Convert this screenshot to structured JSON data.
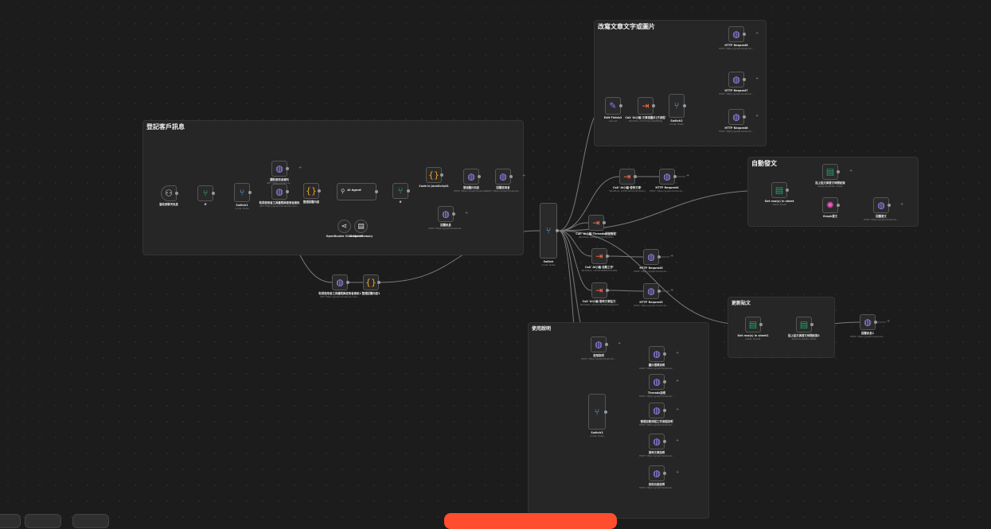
{
  "sticky_notes": [
    {
      "id": "s1",
      "title": "登記客戶訊息"
    },
    {
      "id": "s2",
      "title": "改寫文章文字或圖片"
    },
    {
      "id": "s3",
      "title": "自動發文"
    },
    {
      "id": "s4",
      "title": "使用說明"
    },
    {
      "id": "s5",
      "title": "更新貼文"
    }
  ],
  "nodes": [
    {
      "id": "n_trigger",
      "name": "當收到聊天訊息",
      "sub": "",
      "icon": "trigger-icon"
    },
    {
      "id": "n_if1",
      "name": "If",
      "sub": "",
      "icon": "if-icon"
    },
    {
      "id": "n_switch1",
      "name": "Switch1",
      "sub": "mode: Rules",
      "icon": "switch-icon"
    },
    {
      "id": "n_http_a",
      "name": "讀取使用者資料",
      "sub": "GET: https://graph.fa...",
      "icon": "globe-icon"
    },
    {
      "id": "n_http_b",
      "name": "取得使用者工具權限與使用者資訊",
      "sub": "GET: https://graph.facebook.com/...",
      "icon": "globe-icon"
    },
    {
      "id": "n_code1",
      "name": "整理回覆內容",
      "sub": "",
      "icon": "code-icon"
    },
    {
      "id": "n_agent",
      "name": "AI Agent",
      "sub": "",
      "icon": "agent-icon"
    },
    {
      "id": "n_model",
      "name": "OpenRouter Chat Model",
      "sub": "",
      "icon": "model-icon"
    },
    {
      "id": "n_memory",
      "name": "Simple Memory",
      "sub": "",
      "icon": "memory-icon"
    },
    {
      "id": "n_if2",
      "name": "If",
      "sub": "",
      "icon": "if-icon"
    },
    {
      "id": "n_code2",
      "name": "Code in JavaScript1",
      "sub": "",
      "icon": "code-icon"
    },
    {
      "id": "n_http_c",
      "name": "發送圖片訊息",
      "sub": "POST: https://graph.facebook...",
      "icon": "globe-icon"
    },
    {
      "id": "n_http_d",
      "name": "回覆使用者",
      "sub": "POST: https://graph.facebook...",
      "icon": "globe-icon"
    },
    {
      "id": "n_http_e",
      "name": "回覆訊息",
      "sub": "POST: https://graph.facebook...",
      "icon": "globe-icon"
    },
    {
      "id": "n_http_f",
      "name": "取得使用者工具權限與使用者資訊1",
      "sub": "GET: https://graph.facebook.com/...",
      "icon": "globe-icon"
    },
    {
      "id": "n_code3",
      "name": "整理回覆內容1",
      "sub": "",
      "icon": "code-icon"
    },
    {
      "id": "n_switch_main",
      "name": "Switch",
      "sub": "mode: Rules",
      "icon": "switch-icon"
    },
    {
      "id": "n_edit",
      "name": "Edit Fields2",
      "sub": "manual",
      "icon": "edit-icon"
    },
    {
      "id": "n_exec1",
      "name": "Call 'AI小編-文章或圖片]子流程'",
      "sub": "Workflow: tmFcDyb7pNvtNDgJ",
      "icon": "exec-icon"
    },
    {
      "id": "n_switch2",
      "name": "Switch2",
      "sub": "mode: Rules",
      "icon": "switch-icon"
    },
    {
      "id": "n_http_g",
      "name": "HTTP Request6",
      "sub": "POST: https://graph.facebook...",
      "icon": "globe-icon"
    },
    {
      "id": "n_http_h",
      "name": "HTTP Request7",
      "sub": "POST: https://graph.facebook...",
      "icon": "globe-icon"
    },
    {
      "id": "n_http_i",
      "name": "HTTP Request8",
      "sub": "POST: https://graph.facebook...",
      "icon": "globe-icon"
    },
    {
      "id": "n_exec2",
      "name": "Call 'AI小編-發佈文章'",
      "sub": "Workflow: zUtzTrwkCkbdmWiwnj",
      "icon": "exec-icon"
    },
    {
      "id": "n_http_j",
      "name": "HTTP Request4",
      "sub": "POST: https://graph.facebook...",
      "icon": "globe-icon"
    },
    {
      "id": "n_exec3",
      "name": "Call 'AI小編-Threads帳號管理'",
      "sub": "Workflow: p6mgk4rnTJm9nXtvu",
      "icon": "exec-icon"
    },
    {
      "id": "n_exec4",
      "name": "Call 'AI小編-自動工作'",
      "sub": "Workflow: nUrTNmN6PwHUreMa",
      "icon": "exec-icon"
    },
    {
      "id": "n_http_k",
      "name": "HTTP Request5",
      "sub": "POST: https://graph.facebook...",
      "icon": "globe-icon"
    },
    {
      "id": "n_exec5",
      "name": "Call 'AI小編-發佈文章貼文'",
      "sub": "Workflow: vlvmwYnWHkHwtpqUmf",
      "icon": "exec-icon"
    },
    {
      "id": "n_http_l",
      "name": "HTTP Request3",
      "sub": "POST: https://graph.facebook...",
      "icon": "globe-icon"
    },
    {
      "id": "n_sheet1",
      "name": "Get row(s) in sheet",
      "sub": "sheet: sheet",
      "icon": "sheet-icon"
    },
    {
      "id": "n_sheet2",
      "name": "貼上貼文與發文時間紀錄",
      "sub": "append/update: sheet",
      "icon": "sheet-icon"
    },
    {
      "id": "n_graph",
      "name": "Graph發文",
      "sub": "",
      "icon": "graph-icon"
    },
    {
      "id": "n_http_m",
      "name": "回覆發文",
      "sub": "POST: https://graph.facebook...",
      "icon": "globe-icon"
    },
    {
      "id": "n_sheet3",
      "name": "Get row(s) in sheet1",
      "sub": "sheet: sheet1",
      "icon": "sheet-icon"
    },
    {
      "id": "n_sheet4",
      "name": "貼上貼文與發文時間紀錄1",
      "sub": "append/update: sheet",
      "icon": "sheet-icon"
    },
    {
      "id": "n_http_n",
      "name": "回覆訊息1",
      "sub": "POST: https://graph.facebook...",
      "icon": "globe-icon"
    },
    {
      "id": "n_http_o",
      "name": "使用說明",
      "sub": "POST: https://graph.facebook...",
      "icon": "globe-icon"
    },
    {
      "id": "n_switch3",
      "name": "Switch3",
      "sub": "mode: Rules",
      "icon": "switch-icon"
    },
    {
      "id": "n_http_p",
      "name": "圖片選單說明",
      "sub": "POST: https://graph.facebook...",
      "icon": "globe-icon"
    },
    {
      "id": "n_http_q",
      "name": "Threads說明",
      "sub": "POST: https://graph.facebook...",
      "icon": "globe-icon"
    },
    {
      "id": "n_http_r",
      "name": "管理自動排程工作流程說明",
      "sub": "POST: https://graph.facebook...",
      "icon": "globe-icon"
    },
    {
      "id": "n_http_s",
      "name": "發佈文章說明",
      "sub": "POST: https://graph.facebook...",
      "icon": "globe-icon"
    },
    {
      "id": "n_http_t",
      "name": "其他功能說明",
      "sub": "POST: https://graph.facebook...",
      "icon": "globe-icon"
    }
  ],
  "icons": {
    "globe-icon": "◍",
    "switch-icon": "⑂",
    "if-icon": "⑂",
    "code-icon": "{}",
    "exec-icon": "⇥",
    "sheet-icon": "▤",
    "edit-icon": "✎",
    "graph-icon": "✺",
    "trigger-icon": "⚇",
    "agent-icon": "⚲",
    "model-icon": "⋖",
    "memory-icon": "▤"
  },
  "toolbar": {
    "run_label": ""
  },
  "colors": {
    "canvas": "#1c1c1c",
    "accent": "#ff4d2e",
    "sticky": "#262626"
  }
}
